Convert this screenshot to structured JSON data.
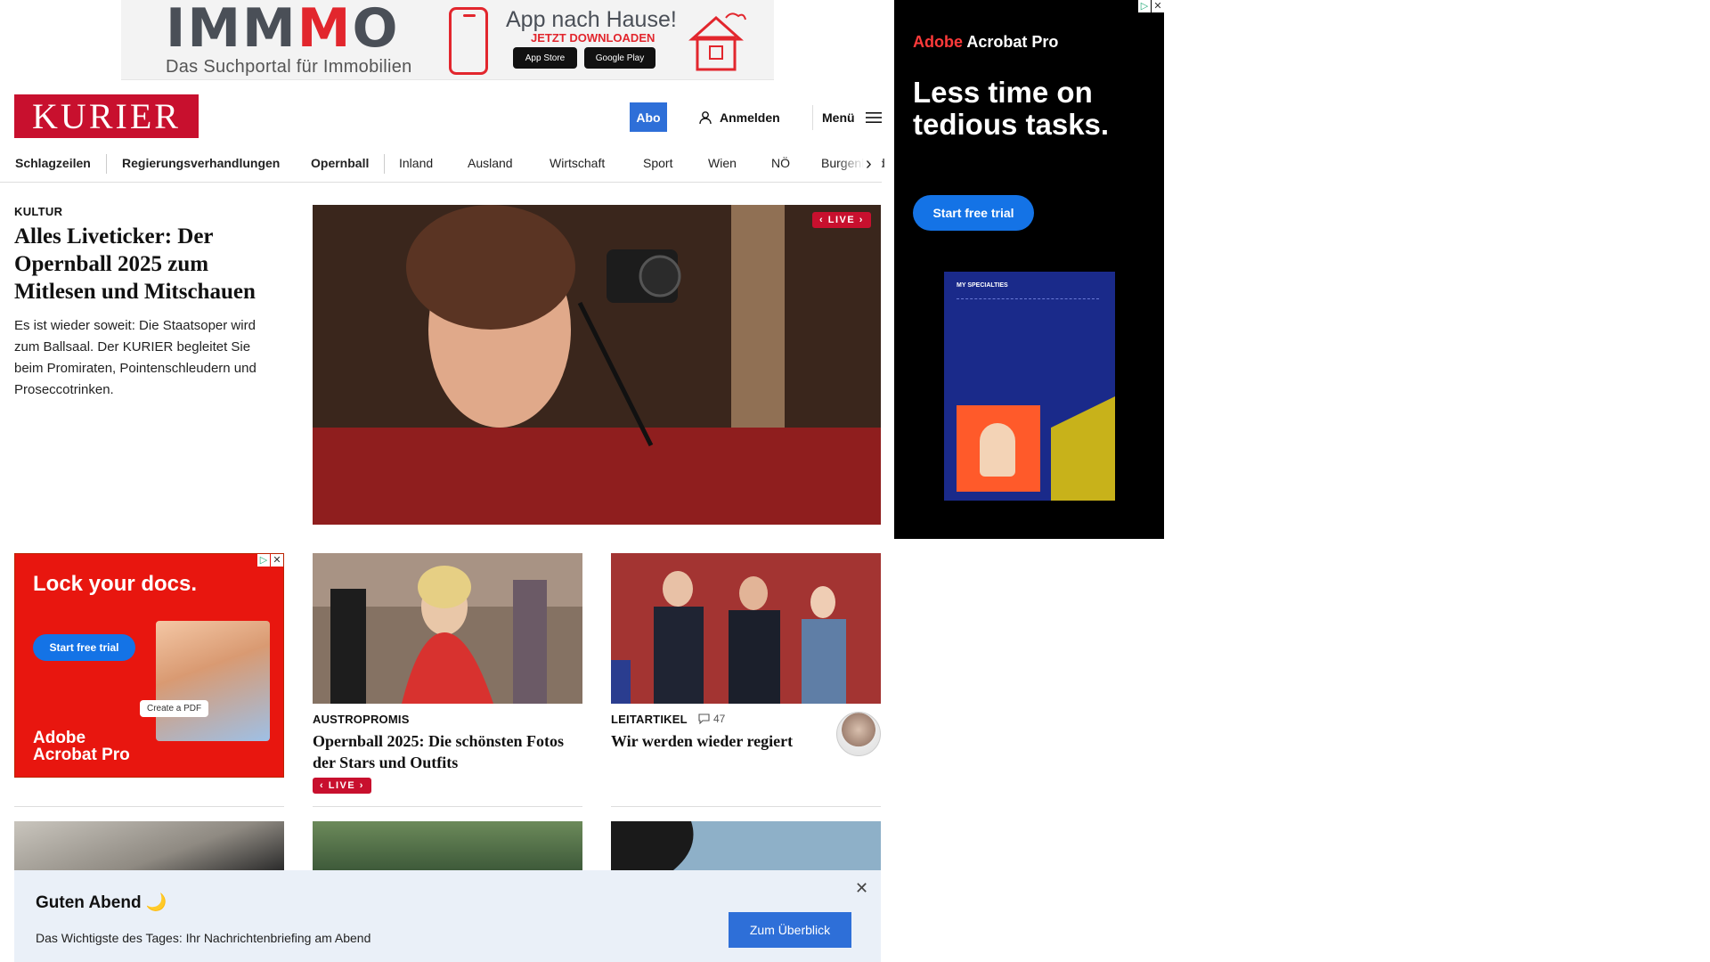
{
  "top_ad": {
    "brand_prefix": "IMM",
    "brand_red": "M",
    "brand_suffix": "O",
    "tagline": "Das Suchportal für Immobilien",
    "app_title": "App nach Hause!",
    "app_subtitle": "JETZT DOWNLOADEN",
    "store_apple": "App Store",
    "store_google": "Google Play"
  },
  "header": {
    "logo": "KURIER",
    "abo_label": "Abo",
    "login_label": "Anmelden",
    "menu_label": "Menü"
  },
  "nav": {
    "items": [
      {
        "label": "Schlagzeilen"
      },
      {
        "label": "Regierungsverhandlungen"
      },
      {
        "label": "Opernball"
      },
      {
        "label": "Inland"
      },
      {
        "label": "Ausland"
      },
      {
        "label": "Wirtschaft"
      },
      {
        "label": "Sport"
      },
      {
        "label": "Wien"
      },
      {
        "label": "NÖ"
      },
      {
        "label": "Burgenland"
      }
    ]
  },
  "lead": {
    "kicker": "KULTUR",
    "title": "Alles Liveticker: Der Opernball 2025 zum Mitlesen und Mitschauen",
    "teaser": "Es ist wieder soweit: Die Staatsoper wird zum Ballsaal. Der KURIER begleitet Sie beim Promiraten, Pointenschleudern und Proseccotrinken.",
    "live_label": "LIVE"
  },
  "sky_ad": {
    "brand_red": "Adobe",
    "brand_white": "Acrobat Pro",
    "headline": "Less time on tedious tasks.",
    "cta": "Start free trial",
    "doc_heading": "MY SPECIALTIES"
  },
  "square_ad": {
    "headline": "Lock your docs.",
    "cta": "Start free trial",
    "chip": "Create a PDF",
    "brand_line1": "Adobe",
    "brand_line2": "Acrobat Pro"
  },
  "cards": [
    {
      "kicker": "AUSTROPROMIS",
      "title": "Opernball 2025: Die schönsten Fotos der Stars und Outfits",
      "live_label": "LIVE"
    },
    {
      "kicker": "LEITARTIKEL",
      "comment_count": "47",
      "title": "Wir werden wieder regiert"
    }
  ],
  "briefing": {
    "greeting": "Guten Abend 🌙",
    "description": "Das Wichtigste des Tages: Ihr Nachrichtenbriefing am Abend",
    "cta": "Zum Überblick"
  },
  "colors": {
    "brand_red": "#c8102e",
    "accent_blue": "#2e6fd8",
    "adobe_blue": "#1473e6"
  }
}
